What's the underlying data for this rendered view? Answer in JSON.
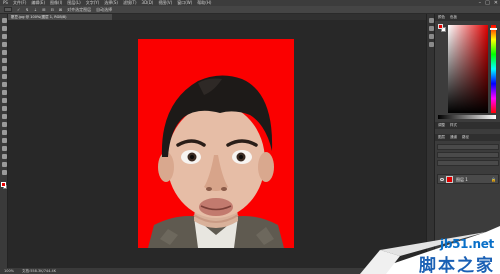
{
  "menubar": {
    "items": [
      "PS",
      "文件(F)",
      "编辑(E)",
      "图像(I)",
      "图层(L)",
      "文字(Y)",
      "选择(S)",
      "滤镜(T)",
      "3D(D)",
      "视图(V)",
      "窗口(W)",
      "帮助(H)"
    ],
    "window_controls": [
      "–",
      "□",
      "✕"
    ]
  },
  "optionsbar": {
    "items": [
      "✓",
      "↯",
      "⇣",
      "⊞",
      "⊟",
      "⊠",
      "对齐选定图层",
      "自动选择"
    ]
  },
  "document": {
    "tab": "憨豆.jpg @ 100%(图层 1, RGB/8)",
    "photo_bg_color": "#fb0000"
  },
  "statusbar": {
    "zoom": "100%",
    "doc_info": "文档:558.3K/744.4K"
  },
  "panels": {
    "color_tabs": [
      "颜色",
      "色板"
    ],
    "adjust_tabs": [
      "调整",
      "样式"
    ],
    "layers_tabs": [
      "图层",
      "通道",
      "路径"
    ],
    "layer_name": "图层 1",
    "lock_glyph": "🔒"
  },
  "colors": {
    "foreground": "#e60000",
    "background": "#ffffff"
  },
  "watermark": {
    "url": "jb51.net",
    "cn": "脚本之家"
  }
}
